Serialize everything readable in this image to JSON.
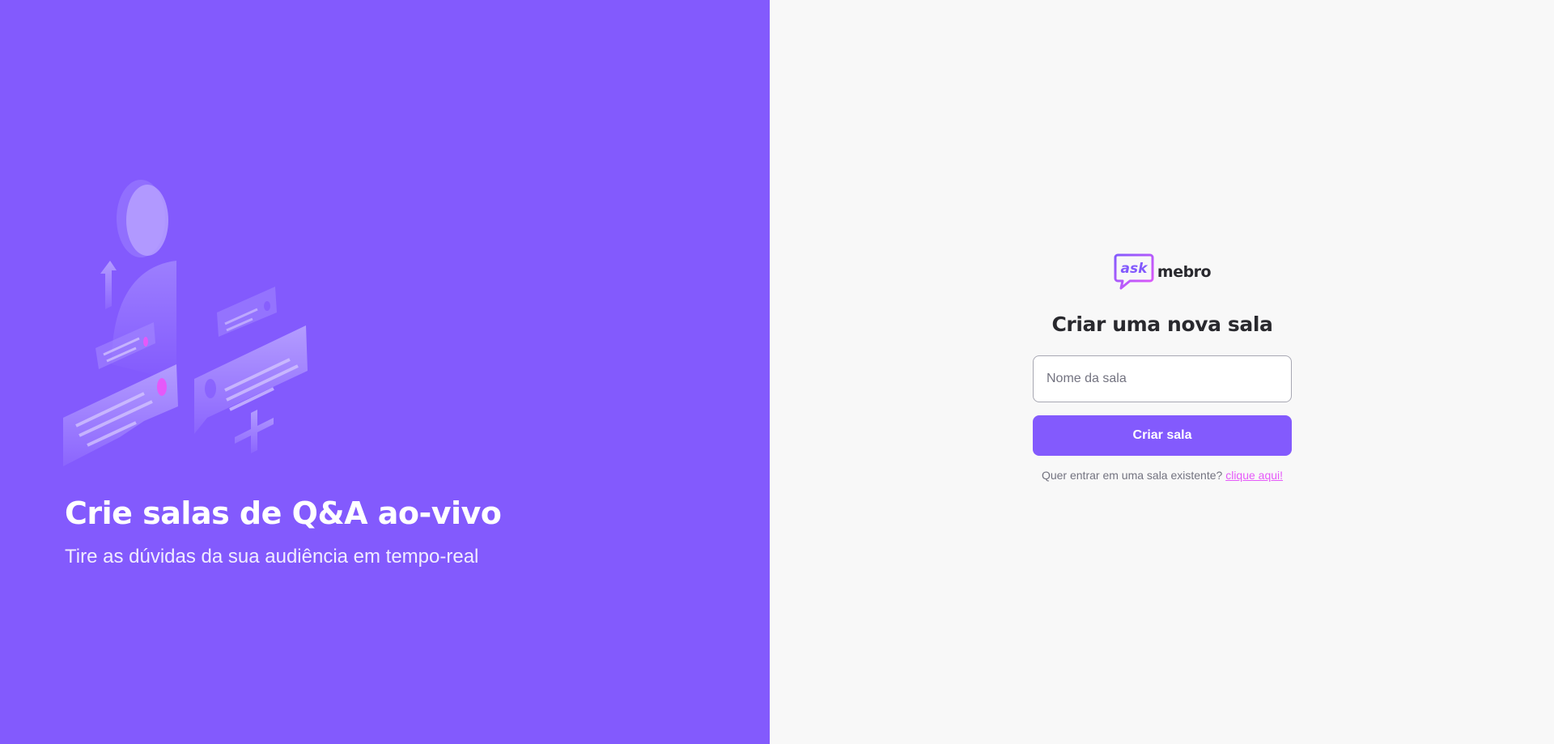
{
  "aside": {
    "illustration_icon": "qa-illustration-icon",
    "title": "Crie salas de Q&A ao-vivo",
    "subtitle": "Tire as dúvidas da sua audiência em tempo-real"
  },
  "logo": {
    "bubble_text": "ask",
    "brand_suffix": "mebro"
  },
  "main": {
    "title": "Criar uma nova sala",
    "room_input_placeholder": "Nome da sala",
    "room_input_value": "",
    "create_button_label": "Criar sala",
    "join_prompt": "Quer entrar em uma sala existente?",
    "join_link_label": "clique aqui!"
  },
  "colors": {
    "primary": "#835afd",
    "accent": "#e559f9",
    "text_dark": "#29292e",
    "text_muted": "#737380",
    "background": "#f8f8f8"
  }
}
